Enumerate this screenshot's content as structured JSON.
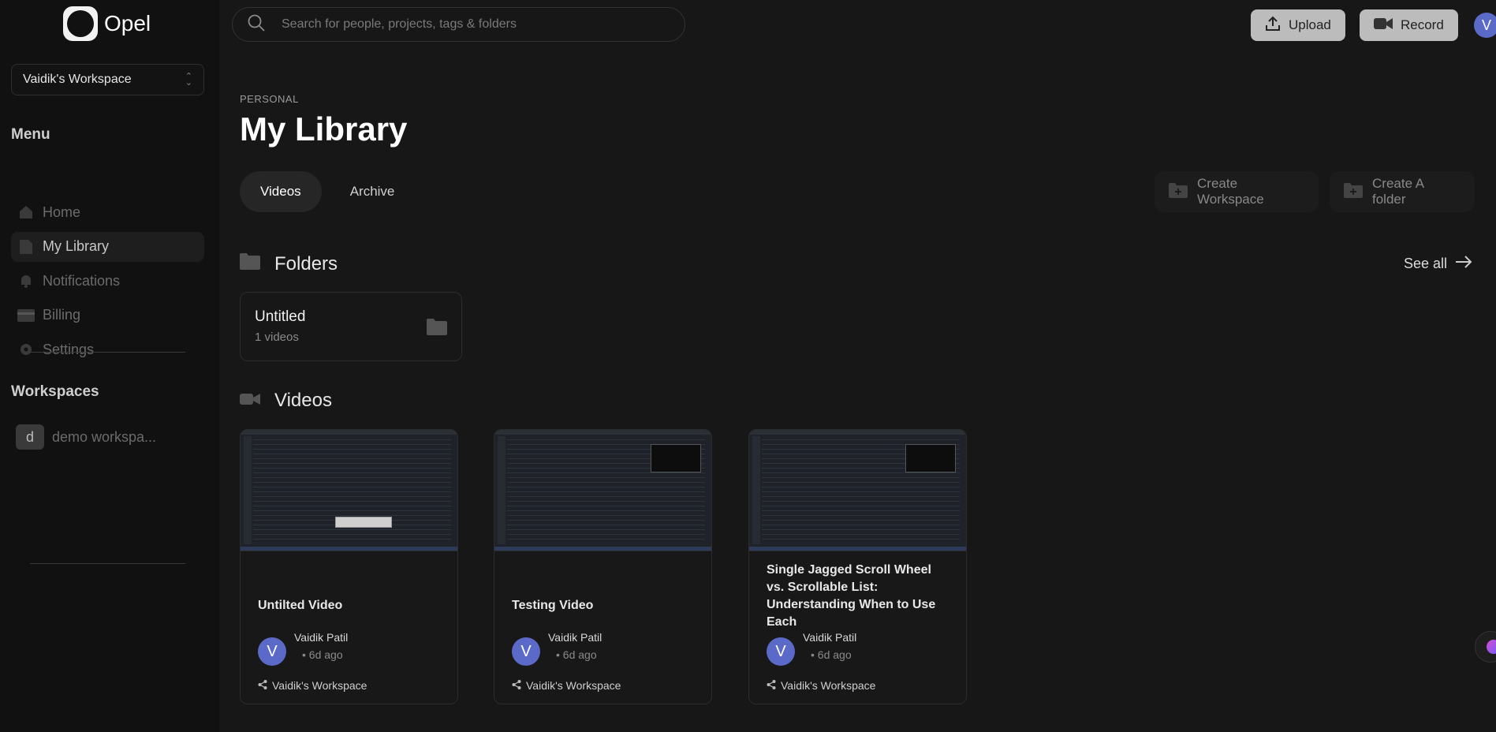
{
  "brand": {
    "name": "Opel"
  },
  "workspace_select": {
    "value": "Vaidik's Workspace"
  },
  "sidebar": {
    "menu_title": "Menu",
    "items": [
      {
        "label": "Home",
        "icon": "home-icon"
      },
      {
        "label": "My Library",
        "icon": "document-icon",
        "active": true
      },
      {
        "label": "Notifications",
        "icon": "bell-icon"
      },
      {
        "label": "Billing",
        "icon": "credit-card-icon"
      },
      {
        "label": "Settings",
        "icon": "gear-icon"
      }
    ],
    "workspaces_title": "Workspaces",
    "workspaces": [
      {
        "initial": "d",
        "label": "demo workspa..."
      }
    ]
  },
  "header": {
    "search_placeholder": "Search for people, projects, tags & folders",
    "upload_label": "Upload",
    "record_label": "Record",
    "avatar_initial": "V"
  },
  "main": {
    "eyebrow": "PERSONAL",
    "title": "My Library",
    "tabs": [
      {
        "label": "Videos",
        "active": true
      },
      {
        "label": "Archive"
      }
    ],
    "create_workspace_label": "Create Workspace",
    "create_folder_label": "Create A folder",
    "folders_title": "Folders",
    "see_all_label": "See all",
    "folders": [
      {
        "name": "Untitled",
        "count": "1 videos"
      }
    ],
    "videos_title": "Videos",
    "videos": [
      {
        "title": "Untilted Video",
        "owner": "Vaidik Patil",
        "owner_initial": "V",
        "time": "6d ago",
        "workspace": "Vaidik's Workspace"
      },
      {
        "title": "Testing Video",
        "owner": "Vaidik Patil",
        "owner_initial": "V",
        "time": "6d ago",
        "workspace": "Vaidik's Workspace"
      },
      {
        "title": "Single Jagged Scroll Wheel vs. Scrollable List: Understanding When to Use Each",
        "owner": "Vaidik Patil",
        "owner_initial": "V",
        "time": "6d ago",
        "workspace": "Vaidik's Workspace"
      }
    ]
  },
  "colors": {
    "background": "#171717",
    "sidebar": "#111111",
    "avatar": "#5b6ac8",
    "button": "#bcbcbc"
  }
}
